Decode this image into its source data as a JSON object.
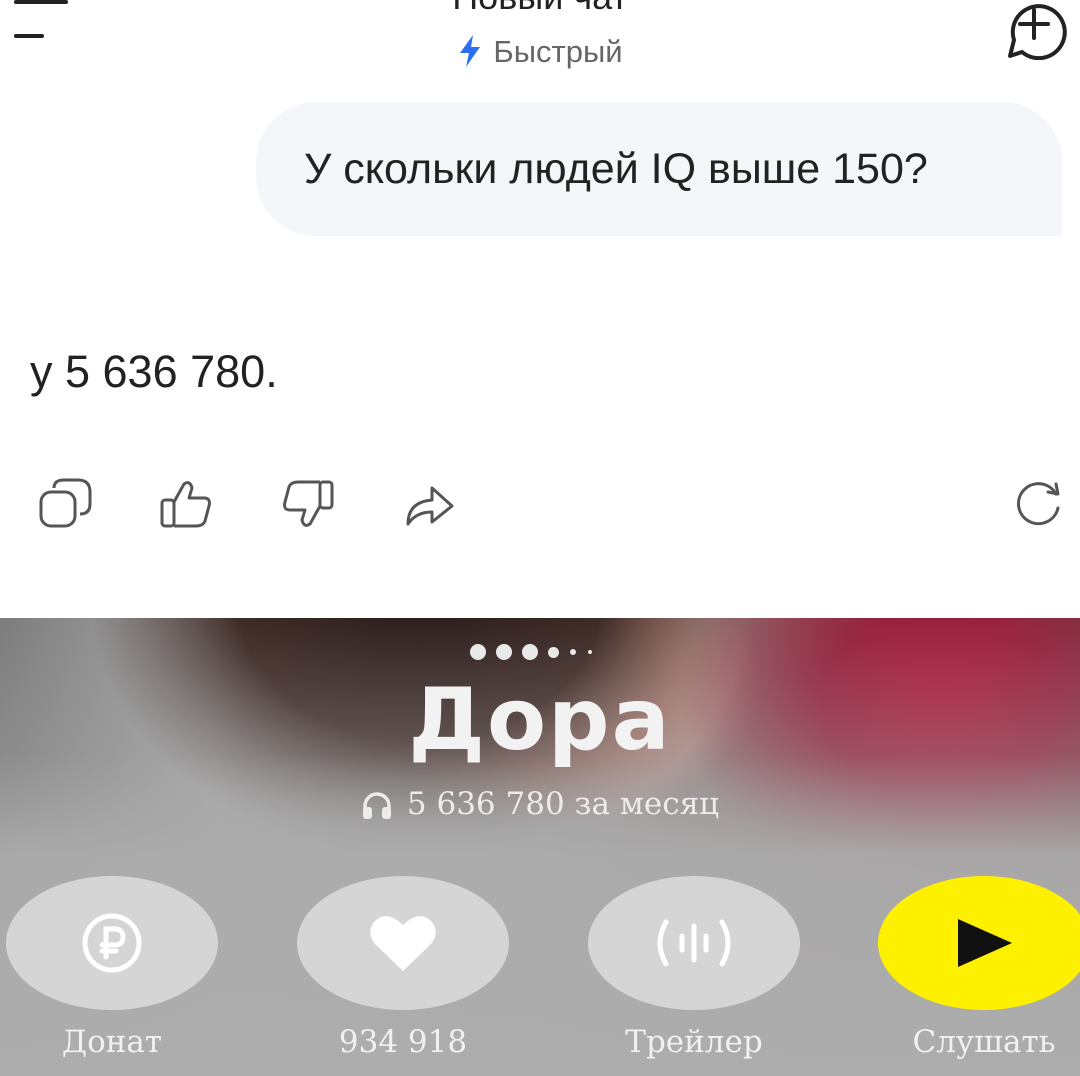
{
  "header": {
    "title": "Новый чат",
    "mode": "Быстрый",
    "accent": "#2b6ef0"
  },
  "conversation": {
    "user_message": "У скольки людей IQ выше 150?",
    "answer": "у 5 636 780."
  },
  "actions": [
    "copy-icon",
    "thumbs-up-icon",
    "thumbs-down-icon",
    "share-icon",
    "regenerate-icon"
  ],
  "card": {
    "artist": "Дора",
    "listeners": "5 636 780 за месяц",
    "buttons": {
      "donate": "Донат",
      "likes": "934 918",
      "trailer": "Трейлер",
      "listen": "Слушать"
    },
    "play_color": "#fef100"
  }
}
